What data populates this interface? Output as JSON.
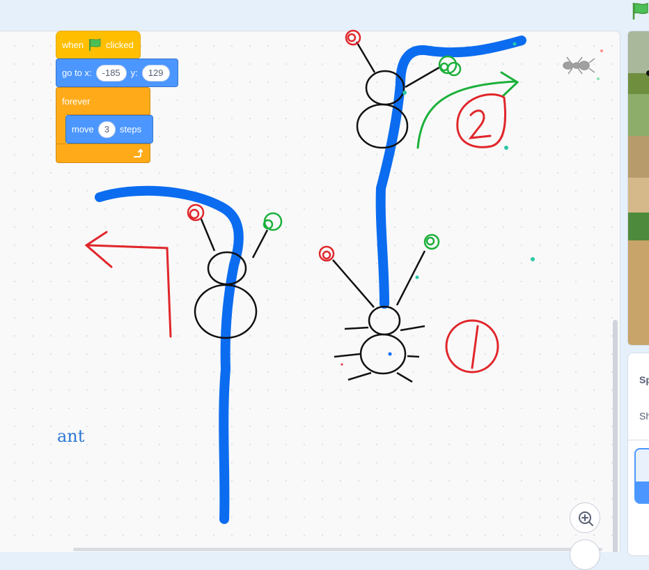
{
  "toolbar": {
    "green_flag_icon": "green-flag-icon"
  },
  "script": {
    "hat_when": "when",
    "hat_flag_icon": "green-flag-icon",
    "hat_clicked": "clicked",
    "goto_label": "go to x:",
    "goto_x": "-185",
    "goto_y_label": "y:",
    "goto_y": "129",
    "forever_label": "forever",
    "move_label": "move",
    "move_steps": "3",
    "steps_label": "steps",
    "loop_arrow_icon": "loop-arrow-icon"
  },
  "annotations": {
    "comment_text": "ant",
    "circle_one": "1",
    "circle_two": "2"
  },
  "sprite_panel": {
    "sprite_label": "Sp",
    "show_label": "Sh"
  },
  "colors": {
    "motion": "#4c97ff",
    "events": "#ffbf00",
    "control": "#ffab19",
    "pen_blue": "#0b6cf0",
    "pen_red": "#e0262b",
    "pen_green": "#1bb03a",
    "pen_black": "#111111"
  }
}
